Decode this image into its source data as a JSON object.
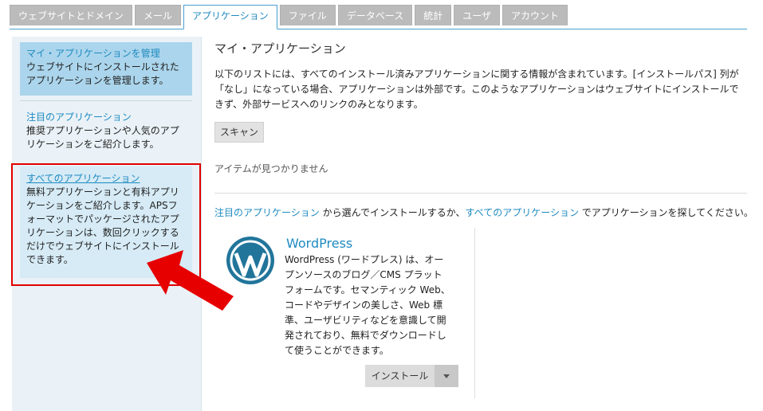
{
  "tabs": [
    {
      "label": "ウェブサイトとドメイン",
      "active": false
    },
    {
      "label": "メール",
      "active": false
    },
    {
      "label": "アプリケーション",
      "active": true
    },
    {
      "label": "ファイル",
      "active": false
    },
    {
      "label": "データベース",
      "active": false
    },
    {
      "label": "統計",
      "active": false
    },
    {
      "label": "ユーザ",
      "active": false
    },
    {
      "label": "アカウント",
      "active": false
    }
  ],
  "sidebar": {
    "items": [
      {
        "title": "マイ・アプリケーションを管理",
        "desc": "ウェブサイトにインストールされたアプリケーションを管理します。"
      },
      {
        "title": "注目のアプリケーション",
        "desc": "推奨アプリケーションや人気のアプリケーションをご紹介します。"
      },
      {
        "title": "すべてのアプリケーション",
        "desc": "無料アプリケーションと有料アプリケーションをご紹介します。APSフォーマットでパッケージされたアプリケーションは、数回クリックするだけでウェブサイトにインストールできます。"
      }
    ]
  },
  "main": {
    "title": "マイ・アプリケーション",
    "intro": "以下のリストには、すべてのインストール済みアプリケーションに関する情報が含まれています。[インストールパス] 列が「なし」になっている場合、アプリケーションは外部です。このようなアプリケーションはウェブサイトにインストールできず、外部サービスへのリンクのみとなります。",
    "scan_label": "スキャン",
    "empty_text": "アイテムが見つかりません",
    "hint": {
      "link1": "注目のアプリケーション",
      "mid": " から選んでインストールするか、",
      "link2": "すべてのアプリケーション",
      "end": " でアプリケーションを探してください。"
    }
  },
  "app_card": {
    "name": "WordPress",
    "description": "WordPress (ワードプレス) は、オープンソースのブログ／CMS プラットフォームです。セマンティック Web、コードやデザインの美しさ、Web 標準、ユーザビリティなどを意識して開発されており、無料でダウンロードして使うことができます。",
    "install_label": "インストール",
    "icon": "wordpress-logo-icon"
  },
  "colors": {
    "link": "#1e8ac0",
    "active_sidebar": "#abd5ec",
    "highlight": "#e30000"
  }
}
